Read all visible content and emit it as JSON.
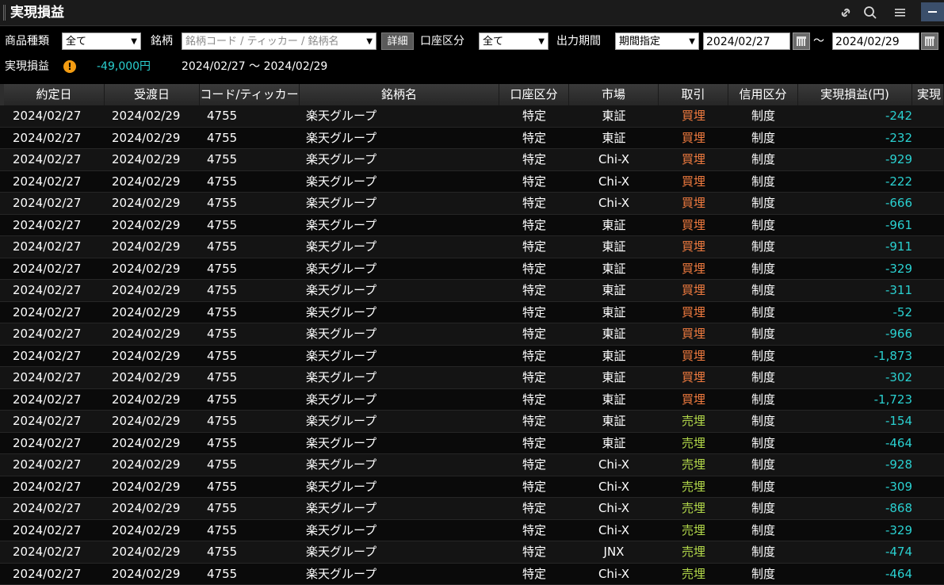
{
  "window": {
    "title": "実現損益"
  },
  "colors": {
    "profit_loss": "#2ad0d0",
    "buy_close": "#f07b3f",
    "sell_close": "#b3d94a",
    "background": "#000000"
  },
  "icons": {
    "link": "link-icon",
    "search": "search-icon",
    "menu": "menu-icon",
    "minimize": "minimize-icon"
  },
  "filters": {
    "product_type_label": "商品種類",
    "product_type_value": "全て",
    "symbol_label": "銘柄",
    "symbol_placeholder": "銘柄コード / ティッカー / 銘柄名",
    "detail_button": "詳細",
    "account_label": "口座区分",
    "account_value": "全て",
    "period_label": "出力期間",
    "period_value": "期間指定",
    "date_from": "2024/02/27",
    "tilde": "～",
    "date_to": "2024/02/29"
  },
  "summary": {
    "label": "実現損益",
    "value": "-49,000円",
    "period": "2024/02/27 ～ 2024/02/29"
  },
  "table": {
    "headers": {
      "trade_date": "約定日",
      "delivery_date": "受渡日",
      "code": "コード/ティッカー",
      "name": "銘柄名",
      "account": "口座区分",
      "market": "市場",
      "transaction": "取引",
      "credit": "信用区分",
      "pl": "実現損益(円)",
      "extra": "実現"
    },
    "rows": [
      {
        "trade": "2024/02/27",
        "deliv": "2024/02/29",
        "code": "4755",
        "name": "楽天グループ",
        "acct": "特定",
        "mkt": "東証",
        "tx": "買埋",
        "side": "buy",
        "credit": "制度",
        "pl": "-242"
      },
      {
        "trade": "2024/02/27",
        "deliv": "2024/02/29",
        "code": "4755",
        "name": "楽天グループ",
        "acct": "特定",
        "mkt": "東証",
        "tx": "買埋",
        "side": "buy",
        "credit": "制度",
        "pl": "-232"
      },
      {
        "trade": "2024/02/27",
        "deliv": "2024/02/29",
        "code": "4755",
        "name": "楽天グループ",
        "acct": "特定",
        "mkt": "Chi-X",
        "tx": "買埋",
        "side": "buy",
        "credit": "制度",
        "pl": "-929"
      },
      {
        "trade": "2024/02/27",
        "deliv": "2024/02/29",
        "code": "4755",
        "name": "楽天グループ",
        "acct": "特定",
        "mkt": "Chi-X",
        "tx": "買埋",
        "side": "buy",
        "credit": "制度",
        "pl": "-222"
      },
      {
        "trade": "2024/02/27",
        "deliv": "2024/02/29",
        "code": "4755",
        "name": "楽天グループ",
        "acct": "特定",
        "mkt": "Chi-X",
        "tx": "買埋",
        "side": "buy",
        "credit": "制度",
        "pl": "-666"
      },
      {
        "trade": "2024/02/27",
        "deliv": "2024/02/29",
        "code": "4755",
        "name": "楽天グループ",
        "acct": "特定",
        "mkt": "東証",
        "tx": "買埋",
        "side": "buy",
        "credit": "制度",
        "pl": "-961"
      },
      {
        "trade": "2024/02/27",
        "deliv": "2024/02/29",
        "code": "4755",
        "name": "楽天グループ",
        "acct": "特定",
        "mkt": "東証",
        "tx": "買埋",
        "side": "buy",
        "credit": "制度",
        "pl": "-911"
      },
      {
        "trade": "2024/02/27",
        "deliv": "2024/02/29",
        "code": "4755",
        "name": "楽天グループ",
        "acct": "特定",
        "mkt": "東証",
        "tx": "買埋",
        "side": "buy",
        "credit": "制度",
        "pl": "-329"
      },
      {
        "trade": "2024/02/27",
        "deliv": "2024/02/29",
        "code": "4755",
        "name": "楽天グループ",
        "acct": "特定",
        "mkt": "東証",
        "tx": "買埋",
        "side": "buy",
        "credit": "制度",
        "pl": "-311"
      },
      {
        "trade": "2024/02/27",
        "deliv": "2024/02/29",
        "code": "4755",
        "name": "楽天グループ",
        "acct": "特定",
        "mkt": "東証",
        "tx": "買埋",
        "side": "buy",
        "credit": "制度",
        "pl": "-52"
      },
      {
        "trade": "2024/02/27",
        "deliv": "2024/02/29",
        "code": "4755",
        "name": "楽天グループ",
        "acct": "特定",
        "mkt": "東証",
        "tx": "買埋",
        "side": "buy",
        "credit": "制度",
        "pl": "-966"
      },
      {
        "trade": "2024/02/27",
        "deliv": "2024/02/29",
        "code": "4755",
        "name": "楽天グループ",
        "acct": "特定",
        "mkt": "東証",
        "tx": "買埋",
        "side": "buy",
        "credit": "制度",
        "pl": "-1,873"
      },
      {
        "trade": "2024/02/27",
        "deliv": "2024/02/29",
        "code": "4755",
        "name": "楽天グループ",
        "acct": "特定",
        "mkt": "東証",
        "tx": "買埋",
        "side": "buy",
        "credit": "制度",
        "pl": "-302"
      },
      {
        "trade": "2024/02/27",
        "deliv": "2024/02/29",
        "code": "4755",
        "name": "楽天グループ",
        "acct": "特定",
        "mkt": "東証",
        "tx": "買埋",
        "side": "buy",
        "credit": "制度",
        "pl": "-1,723"
      },
      {
        "trade": "2024/02/27",
        "deliv": "2024/02/29",
        "code": "4755",
        "name": "楽天グループ",
        "acct": "特定",
        "mkt": "東証",
        "tx": "売埋",
        "side": "sell",
        "credit": "制度",
        "pl": "-154"
      },
      {
        "trade": "2024/02/27",
        "deliv": "2024/02/29",
        "code": "4755",
        "name": "楽天グループ",
        "acct": "特定",
        "mkt": "東証",
        "tx": "売埋",
        "side": "sell",
        "credit": "制度",
        "pl": "-464"
      },
      {
        "trade": "2024/02/27",
        "deliv": "2024/02/29",
        "code": "4755",
        "name": "楽天グループ",
        "acct": "特定",
        "mkt": "Chi-X",
        "tx": "売埋",
        "side": "sell",
        "credit": "制度",
        "pl": "-928"
      },
      {
        "trade": "2024/02/27",
        "deliv": "2024/02/29",
        "code": "4755",
        "name": "楽天グループ",
        "acct": "特定",
        "mkt": "Chi-X",
        "tx": "売埋",
        "side": "sell",
        "credit": "制度",
        "pl": "-309"
      },
      {
        "trade": "2024/02/27",
        "deliv": "2024/02/29",
        "code": "4755",
        "name": "楽天グループ",
        "acct": "特定",
        "mkt": "Chi-X",
        "tx": "売埋",
        "side": "sell",
        "credit": "制度",
        "pl": "-868"
      },
      {
        "trade": "2024/02/27",
        "deliv": "2024/02/29",
        "code": "4755",
        "name": "楽天グループ",
        "acct": "特定",
        "mkt": "Chi-X",
        "tx": "売埋",
        "side": "sell",
        "credit": "制度",
        "pl": "-329"
      },
      {
        "trade": "2024/02/27",
        "deliv": "2024/02/29",
        "code": "4755",
        "name": "楽天グループ",
        "acct": "特定",
        "mkt": "JNX",
        "tx": "売埋",
        "side": "sell",
        "credit": "制度",
        "pl": "-474"
      },
      {
        "trade": "2024/02/27",
        "deliv": "2024/02/29",
        "code": "4755",
        "name": "楽天グループ",
        "acct": "特定",
        "mkt": "Chi-X",
        "tx": "売埋",
        "side": "sell",
        "credit": "制度",
        "pl": "-464"
      }
    ]
  }
}
